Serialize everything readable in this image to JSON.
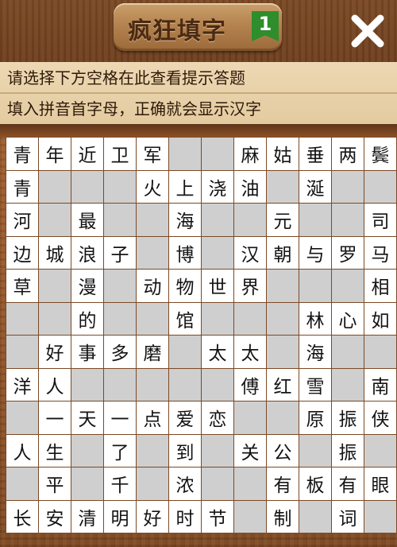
{
  "header": {
    "title": "疯狂填字",
    "level": "1"
  },
  "hints": {
    "line1": "请选择下方空格在此查看提示答题",
    "line2": "填入拼音首字母，正确就会显示汉字"
  },
  "colors": {
    "level_badge": "#2e8d2c",
    "cell_fill": "#ffffff",
    "cell_blank": "#cfcfcf"
  },
  "grid": [
    [
      "青",
      "年",
      "近",
      "卫",
      "军",
      "#",
      "#",
      "麻",
      "姑",
      "垂",
      "两",
      "鬓"
    ],
    [
      "青",
      "#",
      "#",
      "#",
      "火",
      "上",
      "浇",
      "油",
      "#",
      "涎",
      "#",
      "#"
    ],
    [
      "河",
      "#",
      "最",
      "#",
      "#",
      "海",
      "#",
      "#",
      "元",
      "#",
      "#",
      "司"
    ],
    [
      "边",
      "城",
      "浪",
      "子",
      "#",
      "博",
      "#",
      "汉",
      "朝",
      "与",
      "罗",
      "马"
    ],
    [
      "草",
      "#",
      "漫",
      "#",
      "动",
      "物",
      "世",
      "界",
      "#",
      "#",
      "#",
      "相"
    ],
    [
      "#",
      "#",
      "的",
      "#",
      "#",
      "馆",
      "#",
      "#",
      "#",
      "林",
      "心",
      "如"
    ],
    [
      "#",
      "好",
      "事",
      "多",
      "磨",
      "#",
      "太",
      "太",
      "#",
      "海",
      "#",
      "#"
    ],
    [
      "洋",
      "人",
      "#",
      "#",
      "#",
      "#",
      "#",
      "傅",
      "红",
      "雪",
      "#",
      "南"
    ],
    [
      "#",
      "一",
      "天",
      "一",
      "点",
      "爱",
      "恋",
      "#",
      "#",
      "原",
      "振",
      "侠"
    ],
    [
      "人",
      "生",
      "#",
      "了",
      "#",
      "到",
      "#",
      "关",
      "公",
      "#",
      "振",
      "#"
    ],
    [
      "#",
      "平",
      "#",
      "千",
      "#",
      "浓",
      "#",
      "#",
      "有",
      "板",
      "有",
      "眼"
    ],
    [
      "长",
      "安",
      "清",
      "明",
      "好",
      "时",
      "节",
      "#",
      "制",
      "#",
      "词",
      "#"
    ]
  ]
}
